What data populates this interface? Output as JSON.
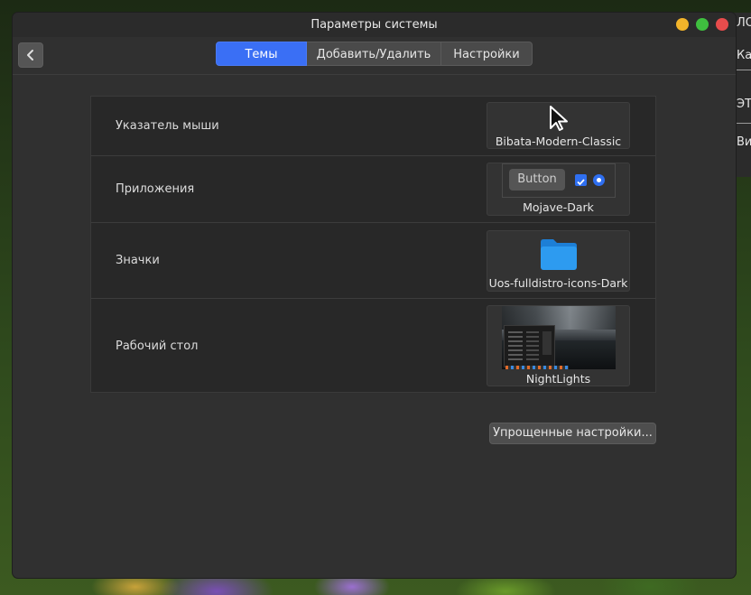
{
  "window": {
    "title": "Параметры системы"
  },
  "toolbar": {
    "tabs": [
      {
        "label": "Темы",
        "active": true
      },
      {
        "label": "Добавить/Удалить",
        "active": false
      },
      {
        "label": "Настройки",
        "active": false
      }
    ]
  },
  "rows": [
    {
      "label": "Указатель мыши",
      "theme": "Bibata-Modern-Classic"
    },
    {
      "label": "Приложения",
      "theme": "Mojave-Dark",
      "preview_button": "Button"
    },
    {
      "label": "Значки",
      "theme": "Uos-fulldistro-icons-Dark"
    },
    {
      "label": "Рабочий стол",
      "theme": "NightLights"
    }
  ],
  "simplified_button": "Упрощенные настройки...",
  "background_window": {
    "lines": [
      "ЛОН",
      "Ка",
      "ЭТО",
      "Ви"
    ]
  },
  "colors": {
    "accent": "#3a6ff5",
    "close": "#e74c4c",
    "minimize": "#f2b42a",
    "maximize": "#3fbf3f",
    "folder": "#2d9bf0"
  }
}
